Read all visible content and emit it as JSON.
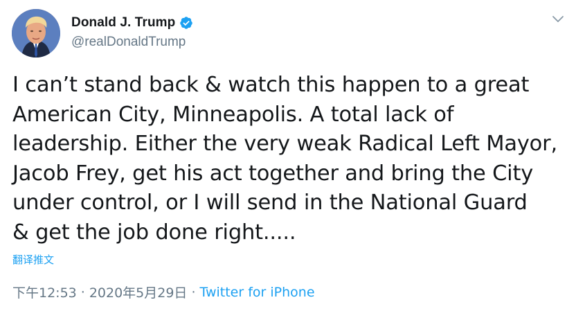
{
  "author": {
    "display_name": "Donald J. Trump",
    "handle": "@realDonaldTrump",
    "verified": true
  },
  "tweet": {
    "text": "I can’t stand back & watch this happen to a great\nAmerican City, Minneapolis. A total lack of\nleadership. Either the very weak Radical Left Mayor,\nJacob Frey, get his act together and bring the City\nunder control, or I will send in the National Guard\n& get the job done right.....",
    "translate_label": "翻译推文",
    "time": "下午12:53",
    "date": "2020年5月29日",
    "separator": "·",
    "source": "Twitter for iPhone"
  },
  "colors": {
    "accent": "#1da1f2",
    "secondary_text": "#657786",
    "primary_text": "#14171a"
  },
  "icons": {
    "verified": "verified-badge-icon",
    "menu": "chevron-down-icon"
  }
}
